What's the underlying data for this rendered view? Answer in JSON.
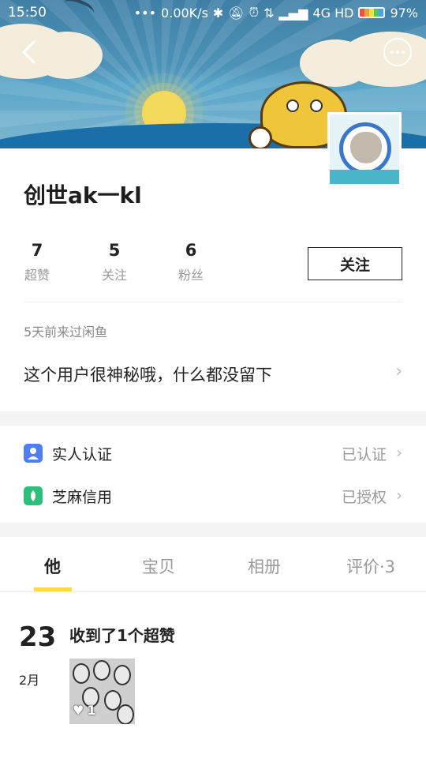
{
  "status_bar": {
    "time": "15:50",
    "network_speed": "0.00K/s",
    "network_type": "4G HD",
    "battery": "97%"
  },
  "profile": {
    "name": "创世ak一kl",
    "stats": [
      {
        "value": "7",
        "label": "超赞"
      },
      {
        "value": "5",
        "label": "关注"
      },
      {
        "value": "6",
        "label": "粉丝"
      }
    ],
    "follow_label": "关注",
    "last_visit": "5天前来过闲鱼",
    "bio": "这个用户很神秘哦，什么都没留下"
  },
  "verification": [
    {
      "label": "实人认证",
      "value": "已认证",
      "icon_color": "#4f7ef0"
    },
    {
      "label": "芝麻信用",
      "value": "已授权",
      "icon_color": "#2fbf7c"
    }
  ],
  "tabs": [
    "他",
    "宝贝",
    "相册",
    "评价·3"
  ],
  "active_tab": 0,
  "feed": {
    "day": "23",
    "month": "2月",
    "title": "收到了1个超赞",
    "likes": "1"
  },
  "colors": {
    "accent": "#ffda44",
    "muted_text": "#999999"
  }
}
